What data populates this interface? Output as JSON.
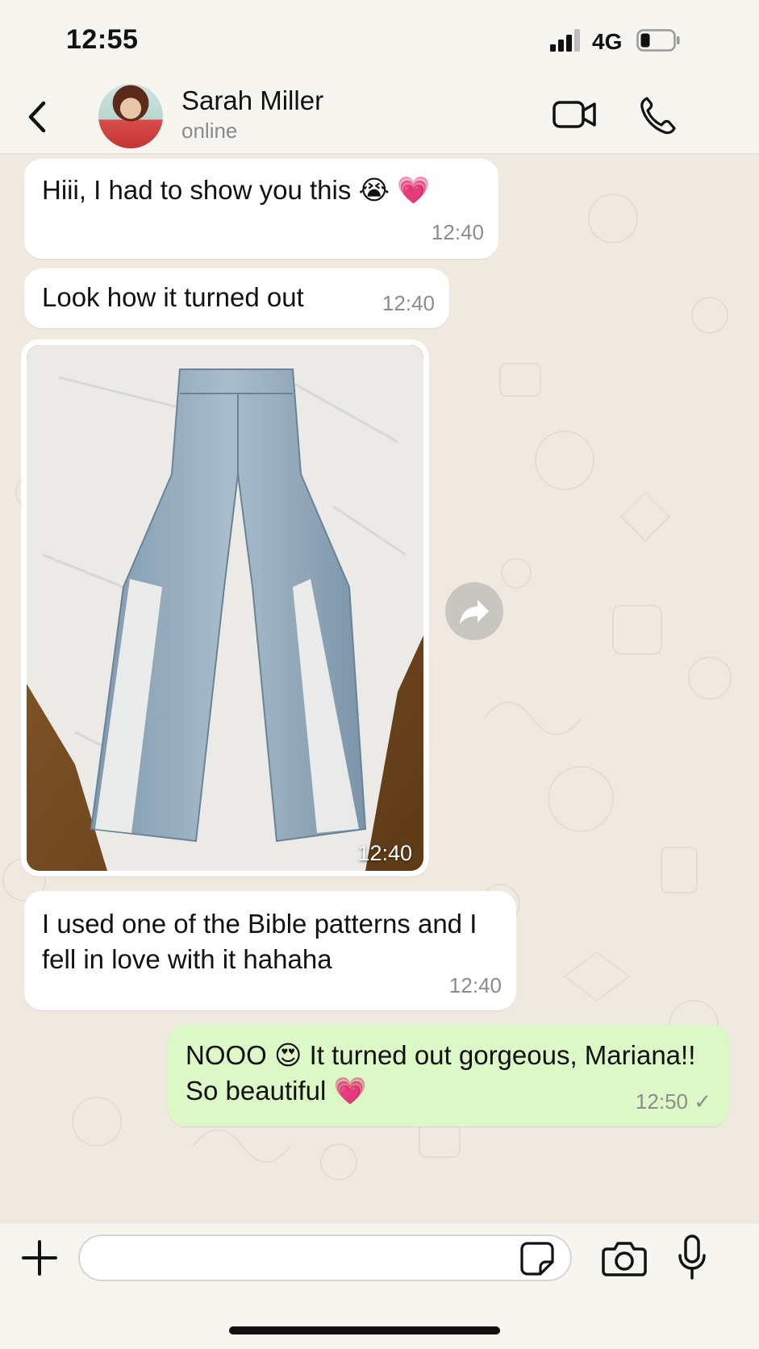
{
  "status_bar": {
    "time": "12:55",
    "network": "4G",
    "signal_icon": "signal-bars-icon",
    "battery_icon": "battery-low-icon"
  },
  "header": {
    "contact_name": "Sarah Miller",
    "contact_status": "online",
    "back_icon": "chevron-left-icon",
    "video_icon": "video-camera-icon",
    "call_icon": "phone-icon"
  },
  "messages": [
    {
      "direction": "in",
      "text": "Hiii, I had to show you this 😭 💗",
      "time": "12:40"
    },
    {
      "direction": "in",
      "text": "Look how it turned out",
      "time": "12:40"
    },
    {
      "direction": "in",
      "type": "photo",
      "time": "12:40"
    },
    {
      "direction": "in",
      "lines": [
        "I used one of the Bible patterns and I",
        "fell in love with it hahaha"
      ],
      "time": "12:40"
    },
    {
      "direction": "out",
      "lines": [
        "NOOO 😍 It turned out gorgeous, Mariana!!",
        "So beautiful 💗"
      ],
      "time": "12:50 ✓"
    }
  ],
  "composer": {
    "placeholder": "",
    "value": ""
  },
  "colors": {
    "chat_background": "#efe9df",
    "incoming_bubble": "#ffffff",
    "outgoing_bubble": "#dcf8c6",
    "bars": "#f7f5f0"
  }
}
